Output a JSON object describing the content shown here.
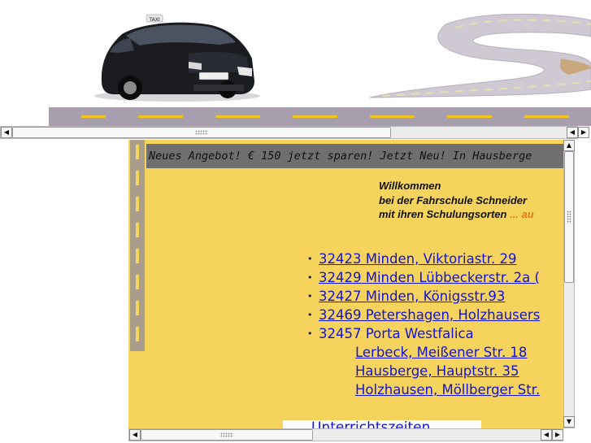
{
  "banner": {
    "car_roof_sign": "TAXI"
  },
  "ticker": {
    "text": "Neues Angebot! € 150 jetzt sparen! Jetzt Neu! In Hausberge"
  },
  "welcome": {
    "line1": "Willkommen",
    "line2": "bei der Fahrschule Schneider",
    "line3": "mit ihren Schulungsorten",
    "line3_suffix": " ... au"
  },
  "locations": [
    {
      "label": "32423 Minden, Viktoriastr. 29",
      "linked": true
    },
    {
      "label": "32429 Minden Lübbeckerstr. 2a (",
      "linked": true
    },
    {
      "label": "32427 Minden, Königsstr.93 ",
      "linked": true
    },
    {
      "label": "32469 Petershagen, Holzhausers",
      "linked": true
    },
    {
      "label": "32457 Porta Westfalica",
      "linked": false
    }
  ],
  "porta_sublocations": [
    "Lerbeck,  Meißener Str. 18",
    "Hausberge, Hauptstr. 35",
    "Holzhausen, Möllberger Str. "
  ],
  "unterricht": {
    "label": "Unterrichtszeiten"
  },
  "scrollbars": {
    "left_arrow": "◀",
    "right_arrow": "▶",
    "up_arrow": "▲",
    "down_arrow": "▼"
  }
}
